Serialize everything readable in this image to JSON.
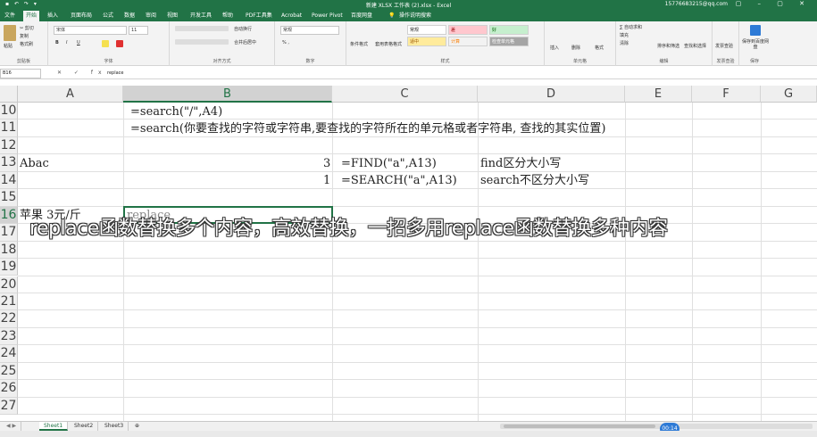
{
  "titlebar": {
    "quick_access": "▪ ↶ ↷ ▾",
    "title": "新建 XLSX 工作表 (2).xlsx - Excel",
    "account": "15776683215@qq.com",
    "controls": "▢ – ▢ ✕"
  },
  "tabs": [
    "文件",
    "开始",
    "插入",
    "页面布局",
    "公式",
    "数据",
    "审阅",
    "视图",
    "开发工具",
    "帮助",
    "PDF工具集",
    "Acrobat",
    "Power Pivot",
    "百度网盘",
    "💡",
    "操作说明搜索"
  ],
  "ribbon": {
    "clipboard": {
      "cut": "✂ 剪切",
      "copy": "复制",
      "format_painter": "格式刷",
      "paste": "粘贴",
      "label": "剪贴板"
    },
    "font": {
      "name": "宋体",
      "size": "11",
      "bold": "B",
      "italic": "I",
      "underline": "U",
      "label": "字体"
    },
    "alignment": {
      "wrap": "自动换行",
      "merge": "合并后居中",
      "label": "对齐方式"
    },
    "number": {
      "format": "常规",
      "pct": "% ,",
      "label": "数字"
    },
    "styles": {
      "cond": "条件格式",
      "table": "套用表格格式",
      "cell_styles": "单元格样式",
      "items": [
        "常规",
        "差",
        "好",
        "适中",
        "计算",
        "检查单元格"
      ],
      "label": "样式"
    },
    "cells": {
      "insert": "插入",
      "delete": "删除",
      "format": "格式",
      "label": "单元格"
    },
    "editing": {
      "autosum": "∑ 自动求和",
      "fill": "填充",
      "clear": "清除",
      "sort": "排序和筛选",
      "find": "查找和选择",
      "label": "编辑"
    },
    "publish": {
      "settings": "发票查验",
      "label": "发票查验"
    },
    "save": {
      "button": "保存到百度网盘",
      "label": "保存"
    }
  },
  "formula_bar": {
    "name_box": "B16",
    "fx": "✕ ✓ fx",
    "content": "replace"
  },
  "columns": [
    "A",
    "B",
    "C",
    "D",
    "E",
    "F",
    "G"
  ],
  "rows": [
    "10",
    "11",
    "12",
    "13",
    "14",
    "15",
    "16",
    "17",
    "18",
    "19",
    "20",
    "21",
    "22",
    "23",
    "24",
    "25",
    "26",
    "27"
  ],
  "cells": {
    "b10": "=search(\"/\",A4)",
    "b11": "=search(你要查找的字符或字符串,要查找的字符所在的单元格或者字符串, 查找的其实位置)",
    "a13": "Abac",
    "b13": "3",
    "c13": "=FIND(\"a\",A13)",
    "d13": "find区分大小写",
    "b14": "1",
    "c14": "=SEARCH(\"a\",A13)",
    "d14": "search不区分大小写",
    "a16": "苹果 3元/斤",
    "b16": "replace"
  },
  "caption": "replace函数替换多个内容，高效替换，一招多用replace函数替换多种内容",
  "sheets": [
    "Sheet1",
    "Sheet2",
    "Sheet3"
  ],
  "add_sheet": "⊕",
  "time_badge": "00:14",
  "colors": {
    "accent": "#217346",
    "badge": "#2d7ad6"
  }
}
